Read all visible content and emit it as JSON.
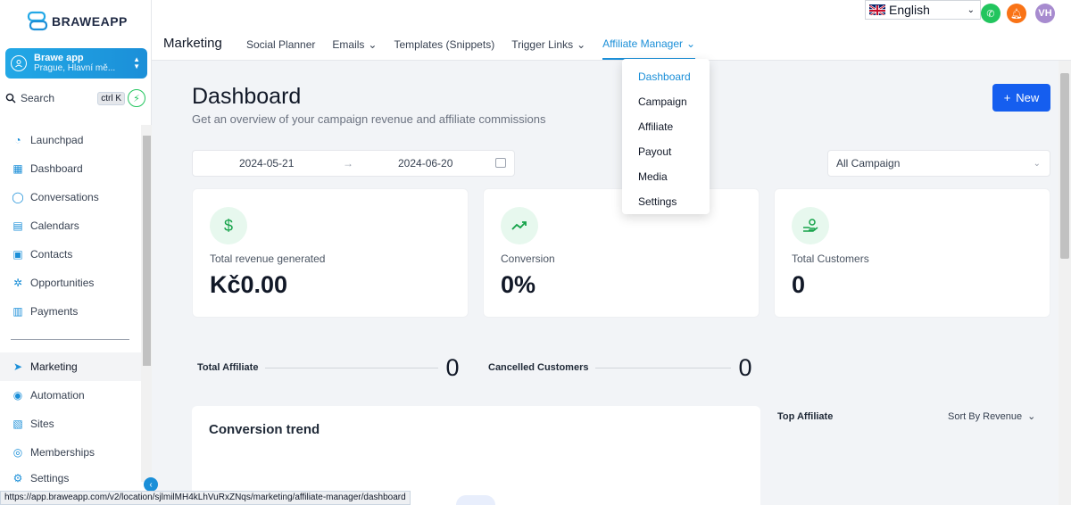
{
  "brand": {
    "name": "BRAWEAPP",
    "accent": "#1b8fd8"
  },
  "account": {
    "name": "Brawe app",
    "location": "Prague, Hlavní mě..."
  },
  "search": {
    "label": "Search",
    "shortcut": "ctrl K"
  },
  "sidebar": {
    "items": [
      {
        "label": "Launchpad",
        "icon": "rocket-icon"
      },
      {
        "label": "Dashboard",
        "icon": "grid-icon"
      },
      {
        "label": "Conversations",
        "icon": "chat-icon"
      },
      {
        "label": "Calendars",
        "icon": "calendar-icon"
      },
      {
        "label": "Contacts",
        "icon": "contacts-icon"
      },
      {
        "label": "Opportunities",
        "icon": "network-icon"
      },
      {
        "label": "Payments",
        "icon": "receipt-icon"
      }
    ],
    "items2": [
      {
        "label": "Marketing",
        "icon": "send-icon"
      },
      {
        "label": "Automation",
        "icon": "automation-icon"
      },
      {
        "label": "Sites",
        "icon": "sites-icon"
      },
      {
        "label": "Memberships",
        "icon": "memberships-icon"
      },
      {
        "label": "Settings",
        "icon": "gear-icon"
      }
    ]
  },
  "topbar": {
    "section": "Marketing",
    "tabs": [
      {
        "label": "Social Planner",
        "dropdown": false
      },
      {
        "label": "Emails",
        "dropdown": true
      },
      {
        "label": "Templates (Snippets)",
        "dropdown": false
      },
      {
        "label": "Trigger Links",
        "dropdown": true
      },
      {
        "label": "Affiliate Manager",
        "dropdown": true
      }
    ],
    "language": "English",
    "user_initials": "VH"
  },
  "dropdown": {
    "items": [
      "Dashboard",
      "Campaign",
      "Affiliate",
      "Payout",
      "Media",
      "Settings"
    ]
  },
  "main": {
    "title": "Dashboard",
    "subtitle": "Get an overview of your campaign revenue and affiliate commissions",
    "new_label": "New",
    "date_from": "2024-05-21",
    "date_to": "2024-06-20",
    "campaign_select": "All Campaign",
    "cards": [
      {
        "label": "Total revenue generated",
        "value": "Kč0.00"
      },
      {
        "label": "Conversion",
        "value": "0%"
      },
      {
        "label": "Total Customers",
        "value": "0"
      }
    ],
    "stats": [
      {
        "label": "Total Affiliate",
        "value": "0"
      },
      {
        "label": "Cancelled Customers",
        "value": "0"
      }
    ],
    "trend_title": "Conversion trend",
    "top_affiliate": "Top Affiliate",
    "sort_label": "Sort By Revenue"
  },
  "status_url": "https://app.braweapp.com/v2/location/sjlmilMH4kLhVuRxZNqs/marketing/affiliate-manager/dashboard"
}
